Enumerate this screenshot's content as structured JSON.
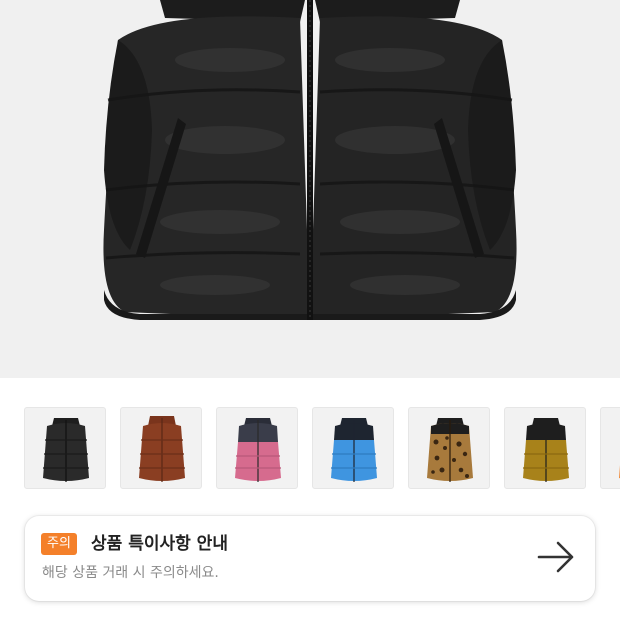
{
  "product": {
    "main_image_icon": "black-puffer-vest-image"
  },
  "color_options": [
    {
      "name": "black",
      "body": "#2a2a2a",
      "shoulder": "#1e1e1e",
      "icon": "black-vest-thumbnail"
    },
    {
      "name": "brown",
      "body": "#8a3e22",
      "shoulder": "#7a341c",
      "icon": "brown-vest-thumbnail"
    },
    {
      "name": "pink",
      "body": "#d66b8e",
      "shoulder": "#3a3d4a",
      "icon": "pink-vest-thumbnail"
    },
    {
      "name": "blue",
      "body": "#3f95e0",
      "shoulder": "#1e2530",
      "icon": "blue-vest-thumbnail"
    },
    {
      "name": "leopard",
      "body": "#a87a3c",
      "shoulder": "#1e1e1e",
      "icon": "leopard-vest-thumbnail"
    },
    {
      "name": "mustard",
      "body": "#a8821a",
      "shoulder": "#1e1e1e",
      "icon": "mustard-vest-thumbnail"
    },
    {
      "name": "orange",
      "body": "#f08a3a",
      "shoulder": "#1e1e1e",
      "icon": "orange-vest-thumbnail"
    }
  ],
  "notice": {
    "badge": "주의",
    "title": "상품 특이사항 안내",
    "subtitle": "해당 상품 거래 시 주의하세요.",
    "arrow_icon": "arrow-right-icon",
    "badge_color": "#f4802a"
  }
}
